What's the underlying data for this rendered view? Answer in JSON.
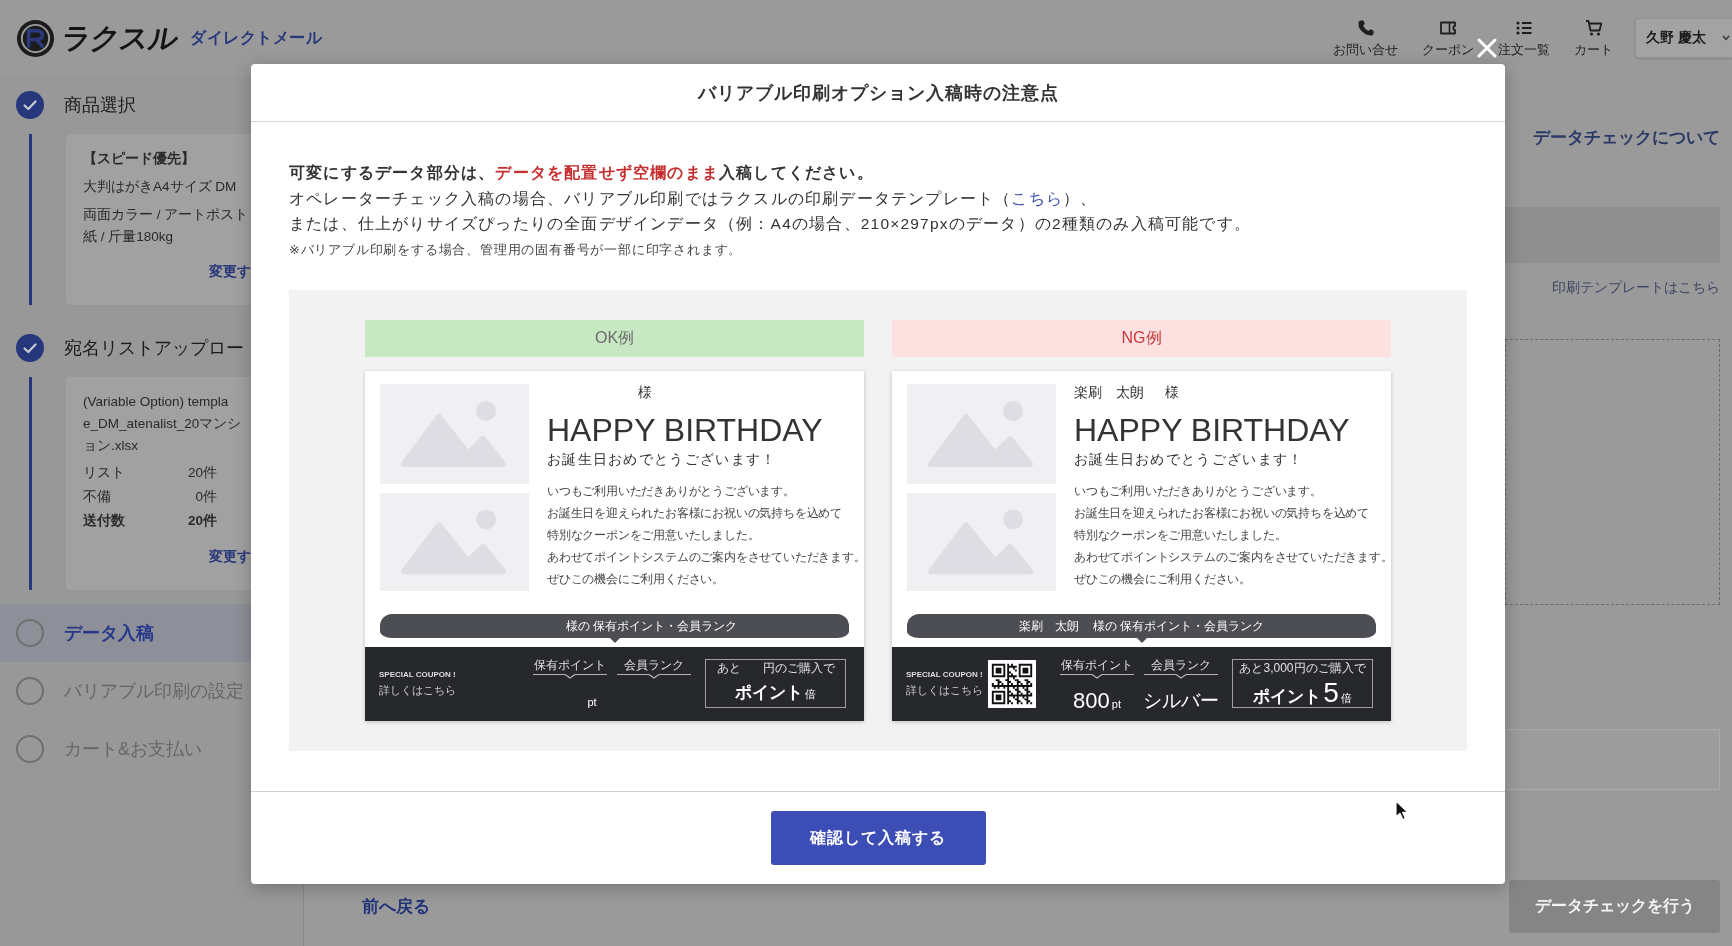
{
  "header": {
    "brand": "ラクスル",
    "service": "ダイレクトメール",
    "nav": [
      {
        "label": "お問い合せ"
      },
      {
        "label": "クーポン"
      },
      {
        "label": "注文一覧"
      },
      {
        "label": "カート"
      }
    ],
    "user": {
      "name": "久野 慶太"
    }
  },
  "sidebar": {
    "steps": [
      {
        "label": "商品選択",
        "checked": true,
        "selected": false,
        "summary": {
          "title": "【スピード優先】",
          "paragraphs": [
            [
              "大判はがきA4サイズ DM"
            ],
            [
              "両面カラー / アートポスト",
              "紙 / 斤量180kg"
            ]
          ],
          "change_link": "変更す"
        }
      },
      {
        "label": "宛名リストアップロー",
        "checked": true,
        "selected": false,
        "summary": {
          "paragraphs": [
            [
              "(Variable Option) templa",
              "e_DM_atenalist_20マンシ",
              "ョン.xlsx"
            ]
          ],
          "stats": [
            {
              "label": "リスト",
              "value": "20件",
              "bold": false
            },
            {
              "label": "不備",
              "value": "0件",
              "bold": false
            },
            {
              "label": "送付数",
              "value": "20件",
              "bold": true
            }
          ],
          "change_link": "変更す"
        }
      },
      {
        "label": "データ入稿",
        "checked": false,
        "selected": true
      },
      {
        "label": "バリアブル印刷の設定",
        "checked": false,
        "selected": false
      },
      {
        "label": "カート&お支払い",
        "checked": false,
        "selected": false
      }
    ]
  },
  "main": {
    "help_link": "データチェックについて",
    "template_link": "印刷テンプレートはこちら",
    "back_link": "前へ戻る",
    "check_button": {
      "label": "データチェックを行う",
      "disabled": true
    }
  },
  "modal": {
    "title": "バリアブル印刷オプション入稿時の注意点",
    "notes": [
      {
        "kind": "lead",
        "segments": [
          {
            "kind": "text",
            "text": "可変にするデータ部分は、"
          },
          {
            "kind": "emphasis",
            "text": "データを配置せず空欄のまま"
          },
          {
            "kind": "text",
            "text": "入稿してください。"
          }
        ]
      },
      {
        "kind": "body",
        "segments": [
          {
            "kind": "text",
            "text": "オペレーターチェック入稿の場合、バリアブル印刷ではラクスルの印刷データテンプレート（"
          },
          {
            "kind": "link",
            "text": "こちら"
          },
          {
            "kind": "text",
            "text": "）、"
          }
        ]
      },
      {
        "kind": "body",
        "segments": [
          {
            "kind": "text",
            "text": "または、仕上がりサイズぴったりの全面デザインデータ（例：A4の場合、210×297pxのデータ）の2種類のみ入稿可能です。"
          }
        ]
      },
      {
        "kind": "footnote",
        "segments": [
          {
            "kind": "text",
            "text": "※バリアブル印刷をする場合、管理用の固有番号が一部に印字されます。"
          }
        ]
      }
    ],
    "examples": [
      {
        "kind": "ok",
        "label": "OK例",
        "addressee": {
          "honorific": "様"
        },
        "headline": "HAPPY BIRTHDAY",
        "greeting": "お誕生日おめでとうございます！",
        "message": [
          "いつもご利用いただきありがとうございます。",
          "お誕生日を迎えられたお客様にお祝いの気持ちを込めて",
          "特別なクーポンをご用意いたしました。",
          "あわせてポイントシステムのご案内をさせていただきます。",
          "ぜひこの機会にご利用ください。"
        ],
        "banner": {
          "text": "様の 保有ポイント・会員ランク"
        },
        "coupon": {
          "title": "SPECIAL COUPON !",
          "link": "詳しくはこちら",
          "qr": false
        },
        "points": {
          "label": "保有ポイント",
          "unit": "pt"
        },
        "rank": {
          "label": "会員ランク"
        },
        "offer": {
          "prefix": "あと",
          "suffix": "円のご購入で",
          "reward": "ポイント",
          "unit": "倍"
        }
      },
      {
        "kind": "ng",
        "label": "NG例",
        "addressee": {
          "name": "楽刷　太朗",
          "honorific": "様"
        },
        "headline": "HAPPY BIRTHDAY",
        "greeting": "お誕生日おめでとうございます！",
        "message": [
          "いつもご利用いただきありがとうございます。",
          "お誕生日を迎えられたお客様にお祝いの気持ちを込めて",
          "特別なクーポンをご用意いたしました。",
          "あわせてポイントシステムのご案内をさせていただきます。",
          "ぜひこの機会にご利用ください。"
        ],
        "banner": {
          "name": "楽刷　太朗",
          "text": "様の 保有ポイント・会員ランク"
        },
        "coupon": {
          "title": "SPECIAL COUPON !",
          "link": "詳しくはこちら",
          "qr": true
        },
        "points": {
          "label": "保有ポイント",
          "value": "800",
          "unit": "pt"
        },
        "rank": {
          "label": "会員ランク",
          "value": "シルバー"
        },
        "offer": {
          "prefix": "あと",
          "amount": "3,000",
          "suffix": "円のご購入で",
          "reward": "ポイント",
          "multiplier": "5",
          "unit": "倍"
        }
      }
    ],
    "confirm_button": "確認して入稿する"
  }
}
